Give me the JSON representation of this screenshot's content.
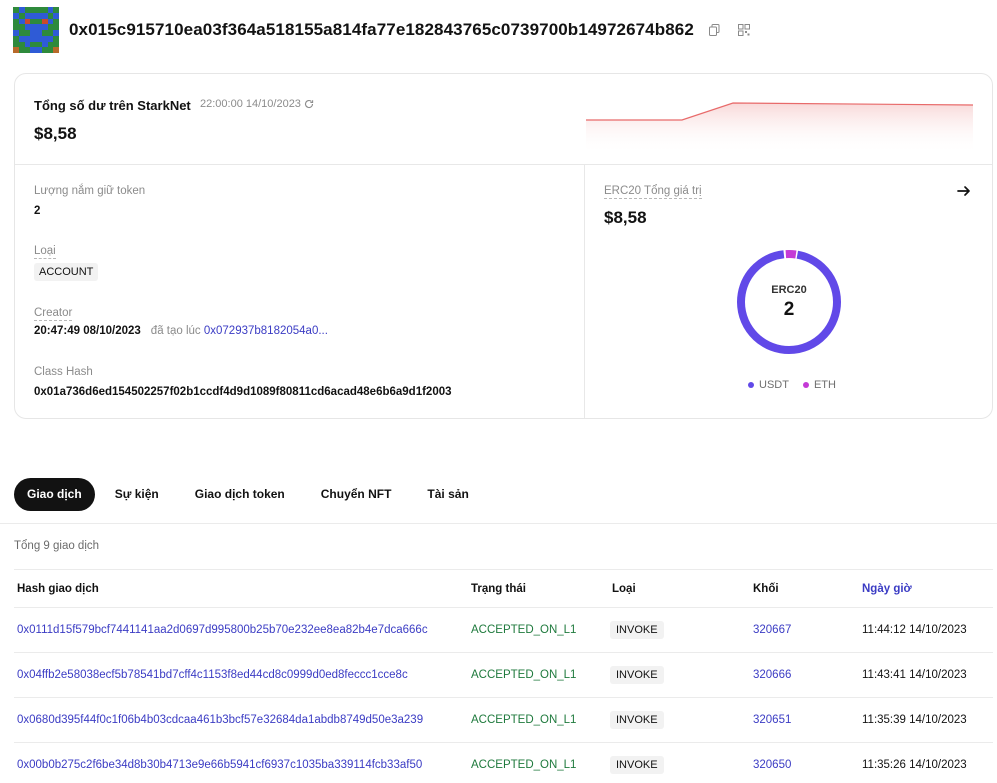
{
  "header": {
    "address": "0x015c915710ea03f364a518155a814fa77e182843765c0739700b14972674b862",
    "copy_icon": "copy-icon",
    "qr_icon": "qr-code-icon"
  },
  "balance": {
    "title": "Tổng số dư trên StarkNet",
    "time": "22:00:00 14/10/2023",
    "value": "$8,58",
    "line_color": "#e86a6a"
  },
  "details": {
    "token_count_label": "Lượng nắm giữ token",
    "token_count_value": "2",
    "type_label": "Loại",
    "type_value": "ACCOUNT",
    "creator_label": "Creator",
    "creator_time": "20:47:49 08/10/2023",
    "creator_prefix": "đã tạo lúc",
    "creator_tx": "0x072937b8182054a0...",
    "class_hash_label": "Class Hash",
    "class_hash_value": "0x01a736d6ed154502257f02b1ccdf4d9d1089f80811cd6acad48e6b6a9d1f2003"
  },
  "erc20": {
    "label": "ERC20 Tổng giá trị",
    "value": "$8,58",
    "center_label": "ERC20",
    "center_value": "2",
    "legend": [
      {
        "name": "USDT",
        "color": "#6149e8"
      },
      {
        "name": "ETH",
        "color": "#c43ad6"
      }
    ],
    "shares": [
      0.96,
      0.04
    ]
  },
  "tabs": [
    {
      "label": "Giao dịch",
      "active": true
    },
    {
      "label": "Sự kiện",
      "active": false
    },
    {
      "label": "Giao dịch token",
      "active": false
    },
    {
      "label": "Chuyển NFT",
      "active": false
    },
    {
      "label": "Tài sản",
      "active": false
    }
  ],
  "total_text": "Tổng 9 giao dịch",
  "table": {
    "headers": [
      "Hash giao dịch",
      "Trạng thái",
      "Loại",
      "Khối",
      "Ngày giờ"
    ],
    "rows": [
      {
        "hash": "0x0111d15f579bcf7441141aa2d0697d995800b25b70e232ee8ea82b4e7dca666c",
        "status": "ACCEPTED_ON_L1",
        "type": "INVOKE",
        "block": "320667",
        "time": "11:44:12 14/10/2023"
      },
      {
        "hash": "0x04ffb2e58038ecf5b78541bd7cff4c1153f8ed44cd8c0999d0ed8feccc1cce8c",
        "status": "ACCEPTED_ON_L1",
        "type": "INVOKE",
        "block": "320666",
        "time": "11:43:41 14/10/2023"
      },
      {
        "hash": "0x0680d395f44f0c1f06b4b03cdcaa461b3bcf57e32684da1abdb8749d50e3a239",
        "status": "ACCEPTED_ON_L1",
        "type": "INVOKE",
        "block": "320651",
        "time": "11:35:39 14/10/2023"
      },
      {
        "hash": "0x00b0b275c2f6be34d8b30b4713e9e66b5941cf6937c1035ba339114fcb33af50",
        "status": "ACCEPTED_ON_L1",
        "type": "INVOKE",
        "block": "320650",
        "time": "11:35:26 14/10/2023"
      }
    ]
  }
}
